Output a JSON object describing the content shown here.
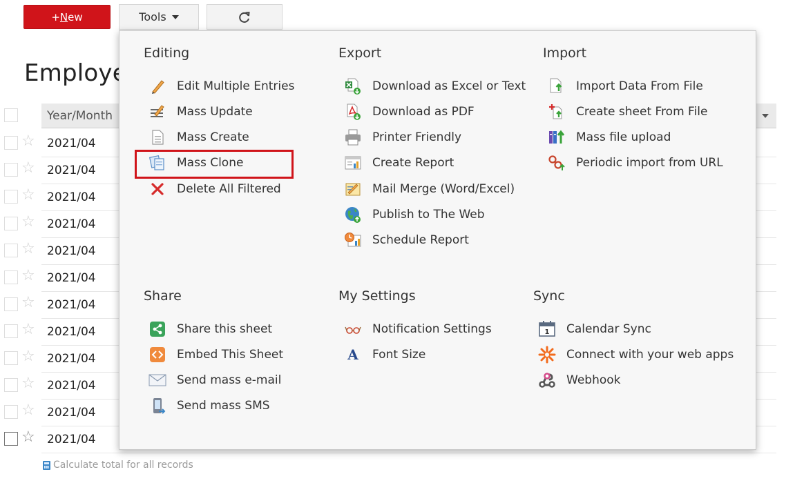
{
  "toolbar": {
    "new_plus": "+",
    "new_underlined": "N",
    "new_rest": "ew",
    "tools_label": "Tools"
  },
  "sheet": {
    "title": "Employee",
    "column_header": "Year/Month",
    "rows": [
      "2021/04",
      "2021/04",
      "2021/04",
      "2021/04",
      "2021/04",
      "2021/04",
      "2021/04",
      "2021/04",
      "2021/04",
      "2021/04",
      "2021/04",
      "2021/04"
    ],
    "calc_total": "Calculate total for all records"
  },
  "menu": {
    "editing": {
      "title": "Editing",
      "items": [
        {
          "label": "Edit Multiple Entries",
          "icon": "pencil-icon"
        },
        {
          "label": "Mass Update",
          "icon": "mass-update-icon"
        },
        {
          "label": "Mass Create",
          "icon": "document-icon"
        },
        {
          "label": "Mass Clone",
          "icon": "clone-icon"
        },
        {
          "label": "Delete All Filtered",
          "icon": "red-x-icon"
        }
      ]
    },
    "export": {
      "title": "Export",
      "items": [
        {
          "label": "Download as Excel or Text",
          "icon": "excel-download-icon"
        },
        {
          "label": "Download as PDF",
          "icon": "pdf-download-icon"
        },
        {
          "label": "Printer Friendly",
          "icon": "printer-icon"
        },
        {
          "label": "Create Report",
          "icon": "report-icon"
        },
        {
          "label": "Mail Merge (Word/Excel)",
          "icon": "mail-merge-icon"
        },
        {
          "label": "Publish to The Web",
          "icon": "globe-icon"
        },
        {
          "label": "Schedule Report",
          "icon": "schedule-report-icon"
        }
      ]
    },
    "import": {
      "title": "Import",
      "items": [
        {
          "label": "Import Data From File",
          "icon": "import-file-icon"
        },
        {
          "label": "Create sheet From File",
          "icon": "create-sheet-icon"
        },
        {
          "label": "Mass file upload",
          "icon": "file-upload-icon"
        },
        {
          "label": "Periodic import from URL",
          "icon": "link-icon"
        }
      ]
    },
    "share": {
      "title": "Share",
      "items": [
        {
          "label": "Share this sheet",
          "icon": "share-icon"
        },
        {
          "label": "Embed This Sheet",
          "icon": "embed-icon"
        },
        {
          "label": "Send mass e-mail",
          "icon": "envelope-icon"
        },
        {
          "label": "Send mass SMS",
          "icon": "mobile-phone-icon"
        }
      ]
    },
    "my_settings": {
      "title": "My Settings",
      "items": [
        {
          "label": "Notification Settings",
          "icon": "glasses-icon"
        },
        {
          "label": "Font Size",
          "icon": "font-icon"
        }
      ]
    },
    "sync": {
      "title": "Sync",
      "items": [
        {
          "label": "Calendar Sync",
          "icon": "calendar-icon"
        },
        {
          "label": "Connect with your web apps",
          "icon": "zapier-icon"
        },
        {
          "label": "Webhook",
          "icon": "webhook-icon"
        }
      ]
    }
  },
  "colors": {
    "brand_red": "#d0141a",
    "highlight_border": "#d0141a"
  }
}
